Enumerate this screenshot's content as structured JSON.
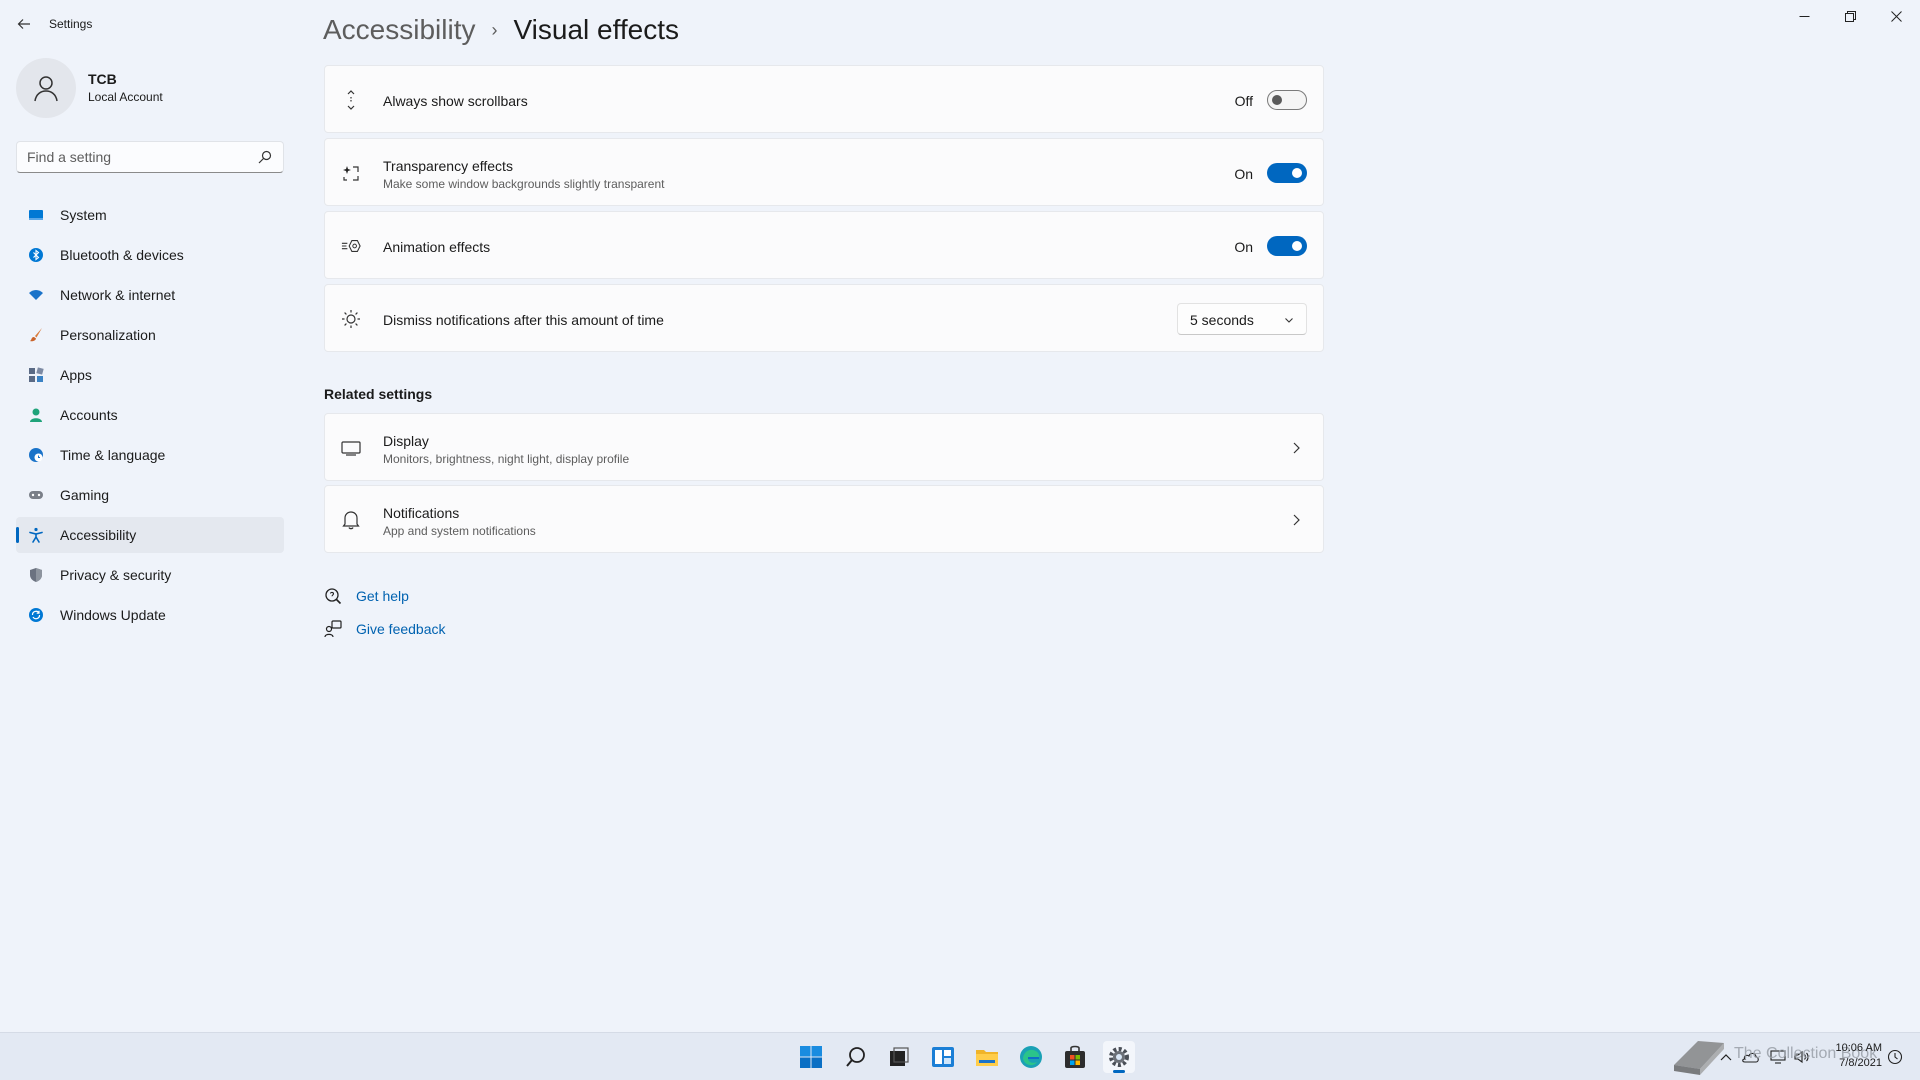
{
  "window": {
    "app_title": "Settings",
    "controls": {
      "minimize": "—",
      "maximize": "❐",
      "close": "✕"
    }
  },
  "profile": {
    "name": "TCB",
    "account_type": "Local Account"
  },
  "search": {
    "placeholder": "Find a setting"
  },
  "sidebar": {
    "items": [
      {
        "label": "System",
        "icon": "monitor-icon",
        "color": "#0078d4"
      },
      {
        "label": "Bluetooth & devices",
        "icon": "bluetooth-icon",
        "color": "#0078d4"
      },
      {
        "label": "Network & internet",
        "icon": "wifi-icon",
        "color": "#1a73c9"
      },
      {
        "label": "Personalization",
        "icon": "brush-icon",
        "color": "#d97a3a"
      },
      {
        "label": "Apps",
        "icon": "apps-icon",
        "color": "#5a6a85"
      },
      {
        "label": "Accounts",
        "icon": "person-icon",
        "color": "#1fa37a"
      },
      {
        "label": "Time & language",
        "icon": "globe-clock-icon",
        "color": "#1a73c9"
      },
      {
        "label": "Gaming",
        "icon": "gamepad-icon",
        "color": "#7a7f88"
      },
      {
        "label": "Accessibility",
        "icon": "accessibility-icon",
        "color": "#0067c0",
        "active": true
      },
      {
        "label": "Privacy & security",
        "icon": "shield-icon",
        "color": "#6b7280"
      },
      {
        "label": "Windows Update",
        "icon": "update-icon",
        "color": "#0078d4"
      }
    ]
  },
  "breadcrumb": {
    "parent": "Accessibility",
    "separator": "›",
    "current": "Visual effects"
  },
  "settings": {
    "scrollbars": {
      "title": "Always show scrollbars",
      "state_label": "Off",
      "on": false,
      "icon": "scrollbar-arrows-icon"
    },
    "transparency": {
      "title": "Transparency effects",
      "description": "Make some window backgrounds slightly transparent",
      "state_label": "On",
      "on": true,
      "icon": "sparkle-frame-icon"
    },
    "animation": {
      "title": "Animation effects",
      "state_label": "On",
      "on": true,
      "icon": "motion-icon"
    },
    "notifications_timeout": {
      "title": "Dismiss notifications after this amount of time",
      "value": "5 seconds",
      "icon": "sun-timer-icon"
    }
  },
  "related": {
    "section_title": "Related settings",
    "items": [
      {
        "title": "Display",
        "description": "Monitors, brightness, night light, display profile",
        "icon": "display-icon"
      },
      {
        "title": "Notifications",
        "description": "App and system notifications",
        "icon": "bell-icon"
      }
    ]
  },
  "help": {
    "get_help": "Get help",
    "give_feedback": "Give feedback"
  },
  "taskbar": {
    "apps": [
      "start-icon",
      "search-icon",
      "task-view-icon",
      "widgets-icon",
      "file-explorer-icon",
      "edge-icon",
      "store-icon",
      "settings-gear-icon"
    ],
    "time": "10:06 AM",
    "date": "7/8/2021",
    "watermark": "The Collection Book"
  },
  "colors": {
    "accent": "#0067c0",
    "link": "#0062b0"
  }
}
